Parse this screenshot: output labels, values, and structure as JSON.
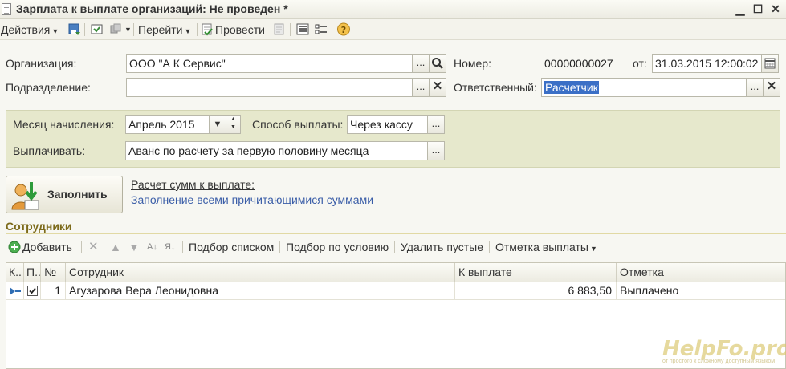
{
  "window": {
    "title": "Зарплата к выплате организаций: Не проведен *",
    "buttons": {
      "minimize": "▁",
      "maximize": "☐",
      "close": "✕"
    }
  },
  "toolbar": {
    "actions": "Действия",
    "goto": "Перейти",
    "post": "Провести"
  },
  "header": {
    "org_label": "Организация:",
    "org_value": "ООО \"А            К              Сервис\"",
    "dept_label": "Подразделение:",
    "dept_value": "",
    "number_label": "Номер:",
    "number_value": "00000000027",
    "date_label": "от:",
    "date_value": "31.03.2015 12:00:02",
    "resp_label": "Ответственный:",
    "resp_value": "Расчетчик"
  },
  "params": {
    "month_label": "Месяц начисления:",
    "month_value": "Апрель 2015",
    "method_label": "Способ выплаты:",
    "method_value": "Через кассу",
    "pay_label": "Выплачивать:",
    "pay_value": "Аванс по расчету за первую половину месяца"
  },
  "fill": {
    "button_label": "Заполнить",
    "calc_link": "Расчет сумм к выплате:",
    "fill_link": "Заполнение всеми причитающимися суммами"
  },
  "employees": {
    "section_title": "Сотрудники",
    "toolbar": {
      "add": "Добавить",
      "pick_list": "Подбор списком",
      "pick_cond": "Подбор по условию",
      "delete_empty": "Удалить пустые",
      "mark_payment": "Отметка выплаты"
    },
    "columns": [
      "К..",
      "П..",
      "№",
      "Сотрудник",
      "К выплате",
      "Отметка"
    ],
    "rows": [
      {
        "num": "1",
        "name": "Агузарова Вера Леонидовна",
        "amount": "6 883,50",
        "mark": "Выплачено",
        "checked": true
      }
    ]
  },
  "watermark": {
    "text": "HelpFo.pro",
    "sub": "от простого к сложному доступным языком"
  },
  "colors": {
    "panel": "#e6e8cc",
    "section_title": "#7c6a1a",
    "link": "#3b5ea8",
    "selection": "#3b6fc6"
  }
}
